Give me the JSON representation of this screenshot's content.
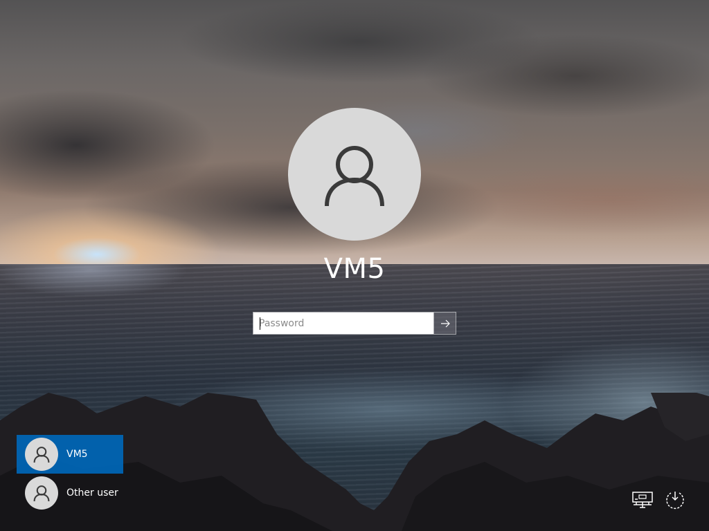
{
  "login": {
    "username": "VM5",
    "password_placeholder": "Password",
    "submit_icon": "arrow-right-icon"
  },
  "user_list": {
    "items": [
      {
        "label": "VM5",
        "icon": "user-icon",
        "selected": true
      },
      {
        "label": "Other user",
        "icon": "user-icon",
        "selected": false
      }
    ]
  },
  "system_tray": {
    "network_icon": "network-icon",
    "power_icon": "power-icon"
  },
  "colors": {
    "selected_user_bg": "#0067b8",
    "avatar_bg": "#d9d9d9",
    "text": "#ffffff"
  }
}
